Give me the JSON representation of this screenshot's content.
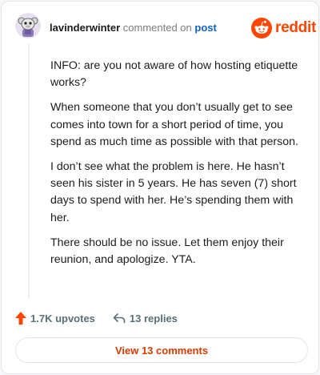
{
  "comment": {
    "username": "lavinderwinter",
    "action_text": "commented on",
    "post_link": "post",
    "paragraphs": [
      "INFO: are you not aware of how hosting etiquette works?",
      "When someone that you don’t usually get to see comes into town for a short period of time, you spend as much time as possible with that person.",
      "I don’t see what the problem is here. He hasn’t seen his sister in 5 years. He has seven (7) short days to spend with her. He’s spending them with her.",
      "There should be no issue. Let them enjoy their reunion, and apologize. YTA."
    ]
  },
  "brand": {
    "name": "reddit",
    "icon": "reddit-snoo-icon",
    "color": "#ff4500"
  },
  "actions": {
    "upvotes_label": "1.7K upvotes",
    "upvote_icon": "upvote-arrow-icon",
    "upvote_color": "#ff4500",
    "replies_label": "13 replies",
    "reply_icon": "reply-arrow-icon"
  },
  "view_comments_label": "View 13 comments",
  "accent_link_color": "#0f61c4",
  "view_button_color": "#d93a00"
}
